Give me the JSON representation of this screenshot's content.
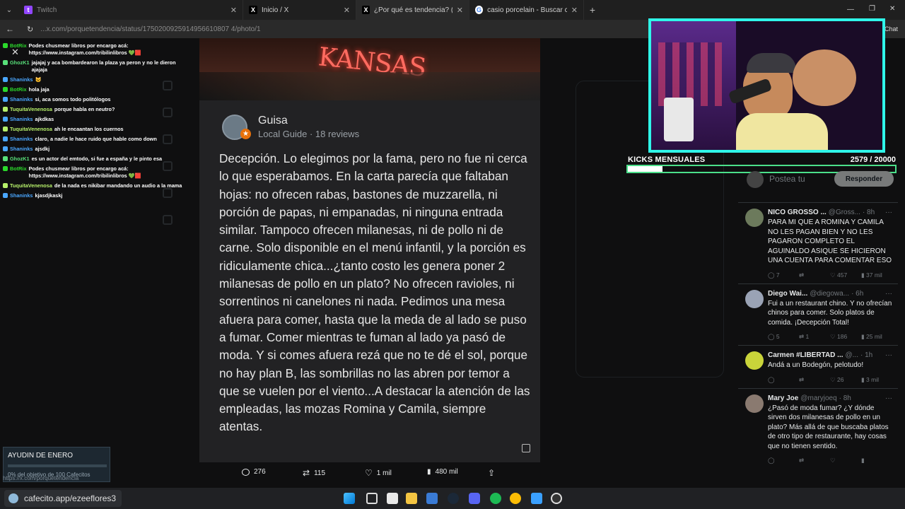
{
  "tabs": [
    {
      "label": "Twitch"
    },
    {
      "label": "Inicio / X"
    },
    {
      "label": "¿Por qué es tendencia? (@porque"
    },
    {
      "label": "casio porcelain - Buscar con Goog"
    }
  ],
  "address": {
    "url": "...x.com/porquetendencia/status/1750200925914956610807 4/photo/1"
  },
  "chat_header": {
    "label": "Chat"
  },
  "chat": [
    {
      "user": "BotRix",
      "color": "#2bd92b",
      "text": "Podes chusmear libros por encargo acá: https://www.instagram.com/tribilinlibros 💚🟥"
    },
    {
      "user": "GhozK1",
      "color": "#58e07a",
      "text": "jajajaj y aca bombardearon la plaza ya peron y no le dieron ajajaja"
    },
    {
      "user": "Shaninks",
      "color": "#4aa7ff",
      "text": "😺"
    },
    {
      "user": "BotRix",
      "color": "#2bd92b",
      "text": "hola jaja"
    },
    {
      "user": "Shaninks",
      "color": "#4aa7ff",
      "text": "si, aca somos todo politólogos"
    },
    {
      "user": "TuquitaVenenosa",
      "color": "#b6f06a",
      "text": "porque habla en neutro?"
    },
    {
      "user": "Shaninks",
      "color": "#4aa7ff",
      "text": "ajkdkas"
    },
    {
      "user": "TuquitaVenenosa",
      "color": "#b6f06a",
      "text": "ah le encaantan los cuernos"
    },
    {
      "user": "Shaninks",
      "color": "#4aa7ff",
      "text": "claro, a nadie le hace ruido que hable como down"
    },
    {
      "user": "Shaninks",
      "color": "#4aa7ff",
      "text": "ajsdkj"
    },
    {
      "user": "GhozK1",
      "color": "#58e07a",
      "text": "es un actor del emtodo, si fue a españa y le pinto esa"
    },
    {
      "user": "BotRix",
      "color": "#2bd92b",
      "text": "Podes chusmear libros por encargo acá: https://www.instagram.com/tribilinlibros 💚🟥"
    },
    {
      "user": "TuquitaVenenosa",
      "color": "#b6f06a",
      "text": "de la nada es nikibar mandando un audio a la mama"
    },
    {
      "user": "Shaninks",
      "color": "#4aa7ff",
      "text": "kjasdjkaskj"
    }
  ],
  "review": {
    "photo_sign": "KANSAS",
    "reviewer": "Guisa",
    "meta": "Local Guide · 18 reviews",
    "body": "Decepción. Lo elegimos por la fama, pero no fue ni cerca lo que esperabamos. En la carta parecía que faltaban hojas: no ofrecen rabas, bastones de muzzarella, ni porción de papas, ni empanadas, ni ninguna entrada similar. Tampoco ofrecen milanesas, ni de pollo ni de carne. Solo disponible en el menú infantil, y la porción es ridiculamente chica...¿tanto costo les genera poner 2 milanesas de pollo en un plato? No ofrecen ravioles, ni sorrentinos ni canelones ni nada. Pedimos una mesa afuera para comer, hasta que la meda de al lado se puso a fumar. Comer mientras te fuman al lado ya pasó de moda. Y si comes afuera rezá que no te dé el sol, porque no hay plan B, las sombrillas no las abren por temor a que se vuelen por el viento...A destacar la atención de las empleadas, las mozas Romina y Camila, siempre atentas."
  },
  "actions": {
    "replies": "276",
    "reposts": "115",
    "likes": "1 mil",
    "views": "480 mil"
  },
  "kicks": {
    "title": "KICKS MENSUALES",
    "count": "2579 / 20000",
    "progress": 0.129
  },
  "reply_box": {
    "placeholder": "Postea tu",
    "button": "Responder"
  },
  "tweets": [
    {
      "name": "NICO GROSSO ...",
      "handle": "@Gross...",
      "time": "· 8h",
      "text": "PARA MI QUE A ROMINA Y CAMILA NO LES PAGAN BIEN Y NO LES PAGARON COMPLETO EL AGUINALDO ASIQUE SE HICIERON UNA CUENTA PARA COMENTAR ESO",
      "replies": "7",
      "reposts": "",
      "likes": "457",
      "views": "37 mil",
      "avatar": "#6c7a5c"
    },
    {
      "name": "Diego Wai...",
      "handle": "@diegowa...",
      "time": "· 6h",
      "text": "Fui a un restaurant chino. Y no ofrecían chinos para comer. Solo platos de comida. ¡Decepción Total!",
      "replies": "5",
      "reposts": "1",
      "likes": "186",
      "views": "25 mil",
      "avatar": "#9aa3b5"
    },
    {
      "name": "Carmen #LIBERTAD ...",
      "handle": "@...",
      "time": "· 1h",
      "text": "Andá a un Bodegón, pelotudo!",
      "replies": "",
      "reposts": "",
      "likes": "26",
      "views": "3 mil",
      "avatar": "#c9d43a"
    },
    {
      "name": "Mary Joe",
      "handle": "@maryjoeq",
      "time": "· 8h",
      "text": "¿Pasó de moda fumar? ¿Y dónde sirven dos milanesas de pollo en un plato? Más allá de que buscaba platos de otro tipo de restaurante, hay cosas que no tienen sentido.",
      "replies": "",
      "reposts": "",
      "likes": "",
      "views": "",
      "avatar": "#8a7a70"
    }
  ],
  "ayudin": {
    "title": "AYUDIN DE ENERO",
    "subtitle": "0% del objetivo de 100 Cafecitos"
  },
  "status_url": "https://x.com/porquetendencia",
  "cafecito": {
    "label": "cafecito.app/ezeeflores3"
  }
}
